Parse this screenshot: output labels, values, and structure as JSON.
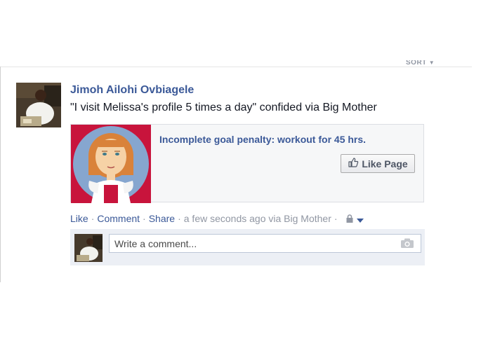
{
  "feed": {
    "sort_label": "SORT"
  },
  "post": {
    "author": "Jimoh Ailohi Ovbiagele",
    "status": "\"I visit Melissa's profile 5 times a day\" confided via Big Mother",
    "attachment": {
      "title": "Incomplete goal penalty: workout for 45 hrs.",
      "like_page_label": "Like Page"
    },
    "actions": {
      "like": "Like",
      "comment": "Comment",
      "share": "Share",
      "sep": "·",
      "timestamp": "a few seconds ago via Big Mother"
    },
    "comment": {
      "placeholder": "Write a comment..."
    }
  },
  "icons": [
    "caret-down-icon",
    "thumbs-up-icon",
    "lock-icon",
    "privacy-dropdown-icon",
    "camera-icon"
  ],
  "colors": {
    "link": "#3b5998",
    "muted": "#9197a3",
    "card_bg": "#f6f7f8",
    "comment_bg": "#eceff5",
    "image_bg": "#c8143c"
  }
}
